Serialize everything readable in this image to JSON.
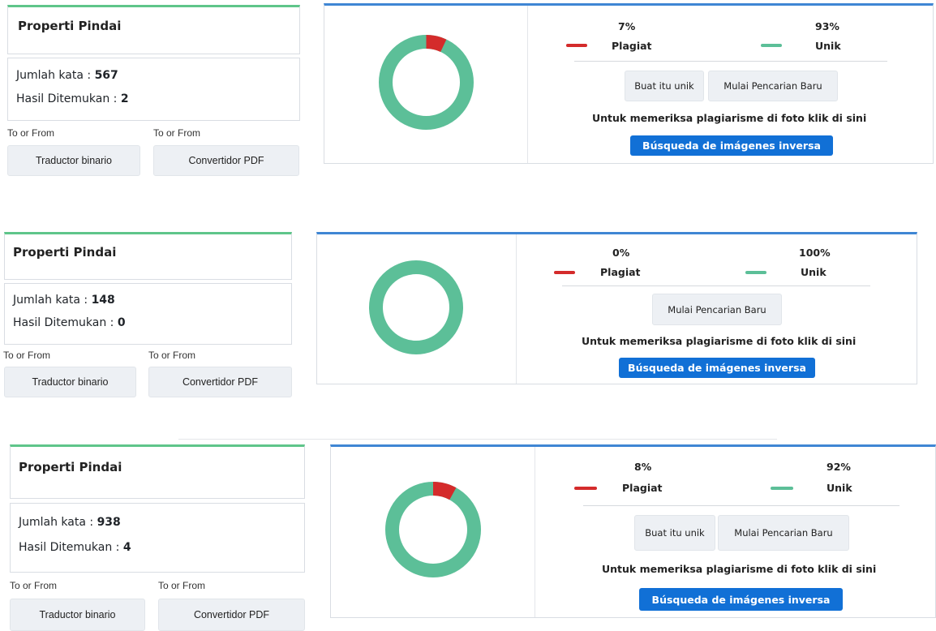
{
  "colors": {
    "plagiat": "#d42b2b",
    "unik": "#5cbf98",
    "accent_green": "#5fc58a",
    "accent_blue": "#3f86d4",
    "button_blue": "#1170d6"
  },
  "panels": [
    {
      "properties_title": "Properti Pindai",
      "word_count_label": "Jumlah kata :",
      "word_count": "567",
      "results_label": "Hasil Ditemukan :",
      "results": "2",
      "to_from_1": "To or From",
      "to_from_2": "To or From",
      "tool_1": "Traductor binario",
      "tool_2": "Convertidor PDF",
      "plagiat_pct": "7%",
      "unik_pct": "93%",
      "plagiat_value": 7,
      "plagiat_label": "Plagiat",
      "unik_label": "Unik",
      "make_unique_label": "Buat itu unik",
      "new_search_label": "Mulai Pencarian Baru",
      "photo_note": "Untuk memeriksa plagiarisme di foto klik di sini",
      "reverse_search_label": "Búsqueda de imágenes inversa"
    },
    {
      "properties_title": "Properti Pindai",
      "word_count_label": "Jumlah kata :",
      "word_count": "148",
      "results_label": "Hasil Ditemukan :",
      "results": "0",
      "to_from_1": "To or From",
      "to_from_2": "To or From",
      "tool_1": "Traductor binario",
      "tool_2": "Convertidor PDF",
      "plagiat_pct": "0%",
      "unik_pct": "100%",
      "plagiat_value": 0,
      "plagiat_label": "Plagiat",
      "unik_label": "Unik",
      "new_search_label": "Mulai Pencarian Baru",
      "photo_note": "Untuk memeriksa plagiarisme di foto klik di sini",
      "reverse_search_label": "Búsqueda de imágenes inversa"
    },
    {
      "properties_title": "Properti Pindai",
      "word_count_label": "Jumlah kata :",
      "word_count": "938",
      "results_label": "Hasil Ditemukan :",
      "results": "4",
      "to_from_1": "To or From",
      "to_from_2": "To or From",
      "tool_1": "Traductor binario",
      "tool_2": "Convertidor PDF",
      "plagiat_pct": "8%",
      "unik_pct": "92%",
      "plagiat_value": 8,
      "plagiat_label": "Plagiat",
      "unik_label": "Unik",
      "make_unique_label": "Buat itu unik",
      "new_search_label": "Mulai Pencarian Baru",
      "photo_note": "Untuk memeriksa plagiarisme di foto klik di sini",
      "reverse_search_label": "Búsqueda de imágenes inversa"
    }
  ]
}
